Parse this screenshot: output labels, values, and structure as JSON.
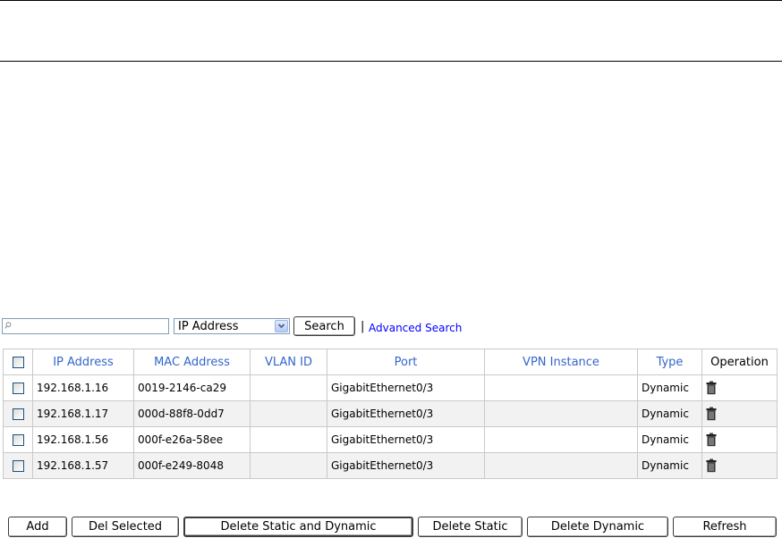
{
  "search": {
    "value": "",
    "placeholder": "",
    "field_selected": "IP Address",
    "search_label": "Search",
    "separator": "|",
    "advanced_label": "Advanced Search"
  },
  "table": {
    "headers": [
      "IP Address",
      "MAC Address",
      "VLAN ID",
      "Port",
      "VPN Instance",
      "Type",
      "Operation"
    ],
    "rows": [
      {
        "ip": "192.168.1.16",
        "mac": "0019-2146-ca29",
        "vlan": "",
        "port": "GigabitEthernet0/3",
        "vpn": "",
        "type": "Dynamic"
      },
      {
        "ip": "192.168.1.17",
        "mac": "000d-88f8-0dd7",
        "vlan": "",
        "port": "GigabitEthernet0/3",
        "vpn": "",
        "type": "Dynamic"
      },
      {
        "ip": "192.168.1.56",
        "mac": "000f-e26a-58ee",
        "vlan": "",
        "port": "GigabitEthernet0/3",
        "vpn": "",
        "type": "Dynamic"
      },
      {
        "ip": "192.168.1.57",
        "mac": "000f-e249-8048",
        "vlan": "",
        "port": "GigabitEthernet0/3",
        "vpn": "",
        "type": "Dynamic"
      }
    ]
  },
  "actions": {
    "add": "Add",
    "del_selected": "Del Selected",
    "delete_static_dynamic": "Delete Static and Dynamic",
    "delete_static": "Delete Static",
    "delete_dynamic": "Delete Dynamic",
    "refresh": "Refresh"
  },
  "icons": {
    "search_box": "search-icon",
    "dropdown": "chevron-down-icon",
    "row_operation": "trash-icon"
  },
  "colors": {
    "header_text": "#3366cc",
    "link": "#0000ff",
    "row_alt_bg": "#f2f2f2",
    "grid_border": "#c9c9c9"
  }
}
